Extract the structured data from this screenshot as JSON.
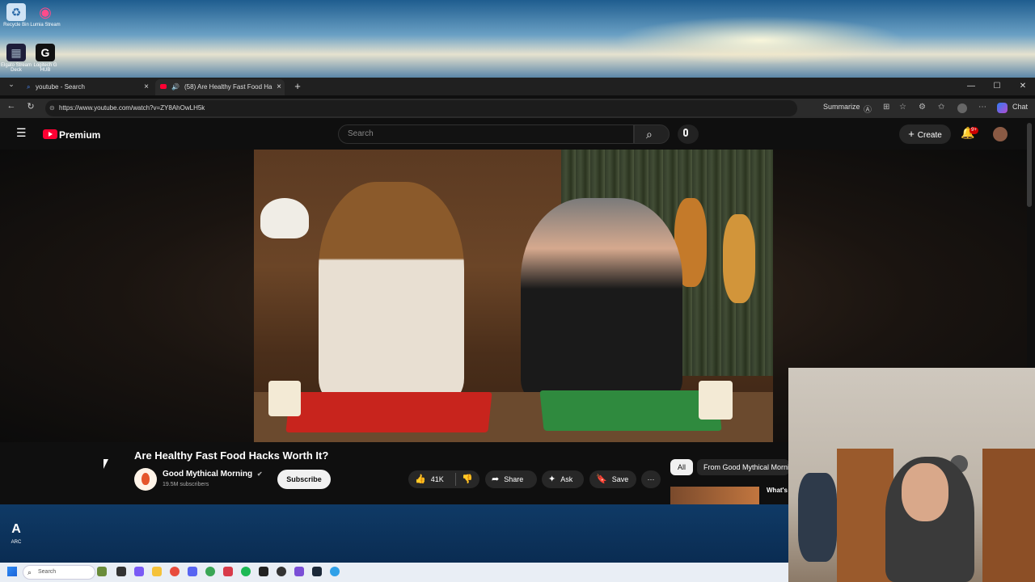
{
  "desktop": {
    "icons": [
      {
        "label": "Recycle Bin",
        "glyph": "♻"
      },
      {
        "label": "Lumia Stream",
        "glyph": "◉"
      },
      {
        "label": "Elgato Stream Deck",
        "glyph": "▦"
      },
      {
        "label": "Logitech G HUB",
        "glyph": "G"
      },
      {
        "label": "ARC",
        "glyph": "A"
      }
    ]
  },
  "browser": {
    "tabs": [
      {
        "title": "youtube - Search",
        "close": "×"
      },
      {
        "title": "(58) Are Healthy Fast Food Ha",
        "close": "×"
      }
    ],
    "new_tab": "+",
    "window_controls": {
      "minimize": "—",
      "maximize": "☐",
      "close": "✕"
    },
    "url": "https://www.youtube.com/watch?v=ZY8AhOwLH5k",
    "summarize_label": "Summarize",
    "chat_label": "Chat"
  },
  "youtube": {
    "logo_text": "Premium",
    "search_placeholder": "Search",
    "create_label": "Create",
    "notification_count": "9+",
    "video": {
      "title": "Are Healthy Fast Food Hacks Worth It?",
      "channel": "Good Mythical Morning",
      "verified": "✔",
      "subscribers": "19.5M subscribers",
      "subscribe_label": "Subscribe",
      "likes": "41K",
      "share_label": "Share",
      "ask_label": "Ask",
      "save_label": "Save",
      "more_label": "···"
    },
    "chips": {
      "all": "All",
      "from": "From Good Mythical Morning"
    },
    "related_title": "What's world"
  },
  "taskbar": {
    "search_placeholder": "Search"
  },
  "colors": {
    "youtube_red": "#ff0033",
    "bg": "#0f0f0f",
    "chip_bg": "#272727"
  }
}
